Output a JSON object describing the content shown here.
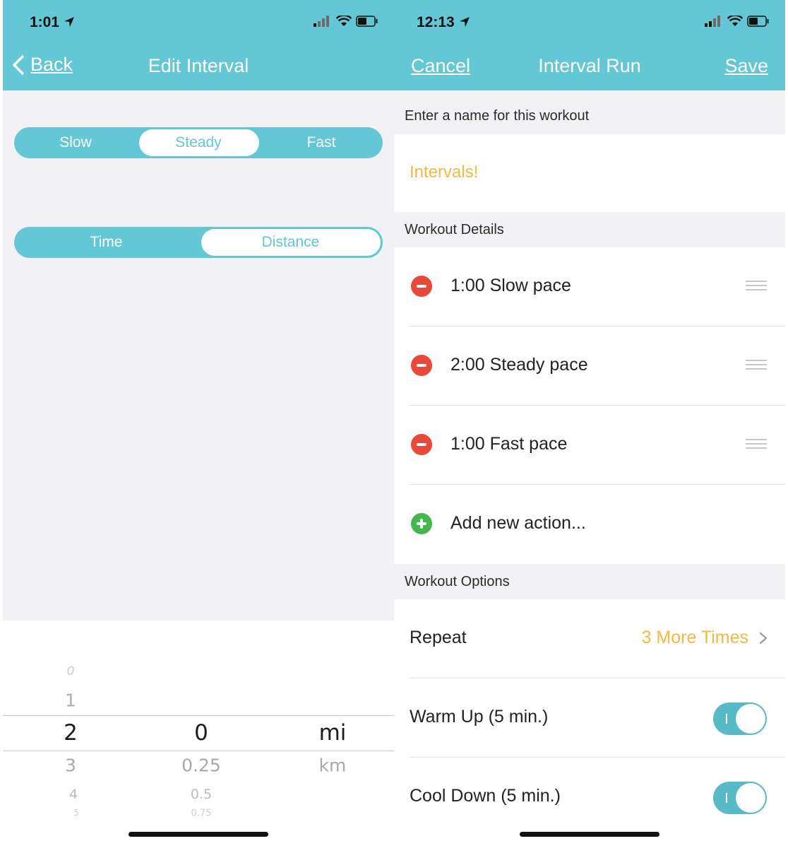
{
  "left": {
    "status_time": "1:01",
    "back_label": "Back",
    "title": "Edit Interval",
    "pace_options": [
      "Slow",
      "Steady",
      "Fast"
    ],
    "pace_selected": "Steady",
    "measure_options": [
      "Time",
      "Distance"
    ],
    "measure_selected": "Distance",
    "picker": {
      "whole": [
        "0",
        "1",
        "2",
        "3",
        "4",
        "5"
      ],
      "fraction": [
        "0",
        "0.25",
        "0.5",
        "0.75"
      ],
      "units": [
        "mi",
        "km"
      ],
      "selected_whole": "2",
      "selected_fraction": "0",
      "selected_unit": "mi"
    }
  },
  "right": {
    "status_time": "12:13",
    "cancel_label": "Cancel",
    "title": "Interval Run",
    "save_label": "Save",
    "name_header": "Enter a name for this workout",
    "workout_name": "Intervals!",
    "details_header": "Workout Details",
    "actions": [
      {
        "label": "1:00 Slow pace"
      },
      {
        "label": "2:00 Steady pace"
      },
      {
        "label": "1:00 Fast pace"
      }
    ],
    "add_action_label": "Add new action...",
    "options_header": "Workout Options",
    "repeat_label": "Repeat",
    "repeat_value": "3 More Times",
    "warmup_label": "Warm Up (5 min.)",
    "warmup_on": true,
    "cooldown_label": "Cool Down (5 min.)",
    "cooldown_on": true
  },
  "colors": {
    "accent": "#63c7d6",
    "highlight": "#f5b942",
    "remove": "#e8473c",
    "add": "#43b64f"
  }
}
